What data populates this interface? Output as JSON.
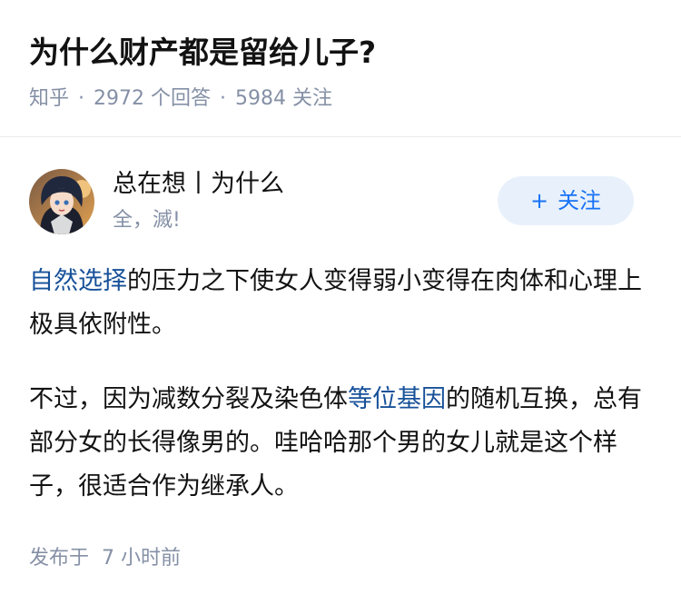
{
  "question": {
    "title": "为什么财产都是留给儿子?",
    "source": "知乎",
    "answers_count": "2972",
    "answers_label": "个回答",
    "followers_count": "5984",
    "followers_label": "关注",
    "separator": "·"
  },
  "author": {
    "name": "总在想丨为什么",
    "bio": "全，滅!",
    "follow_plus": "+",
    "follow_label": "关注",
    "avatar_icon": "anime-avatar-icon"
  },
  "answer": {
    "p1_link": "自然选择",
    "p1_rest": "的压力之下使女人变得弱小变得在肉体和心理上极具依附性。",
    "p2_before": "不过，因为减数分裂及染色体",
    "p2_link": "等位基因",
    "p2_after": "的随机互换，总有部分女的长得像男的。哇哈哈那个男的女儿就是这个样子，很适合作为继承人。"
  },
  "meta": {
    "publish_label": "发布于",
    "publish_time": "7 小时前"
  },
  "colors": {
    "link": "#175199",
    "accent": "#1772f6",
    "muted": "#8590a6"
  }
}
